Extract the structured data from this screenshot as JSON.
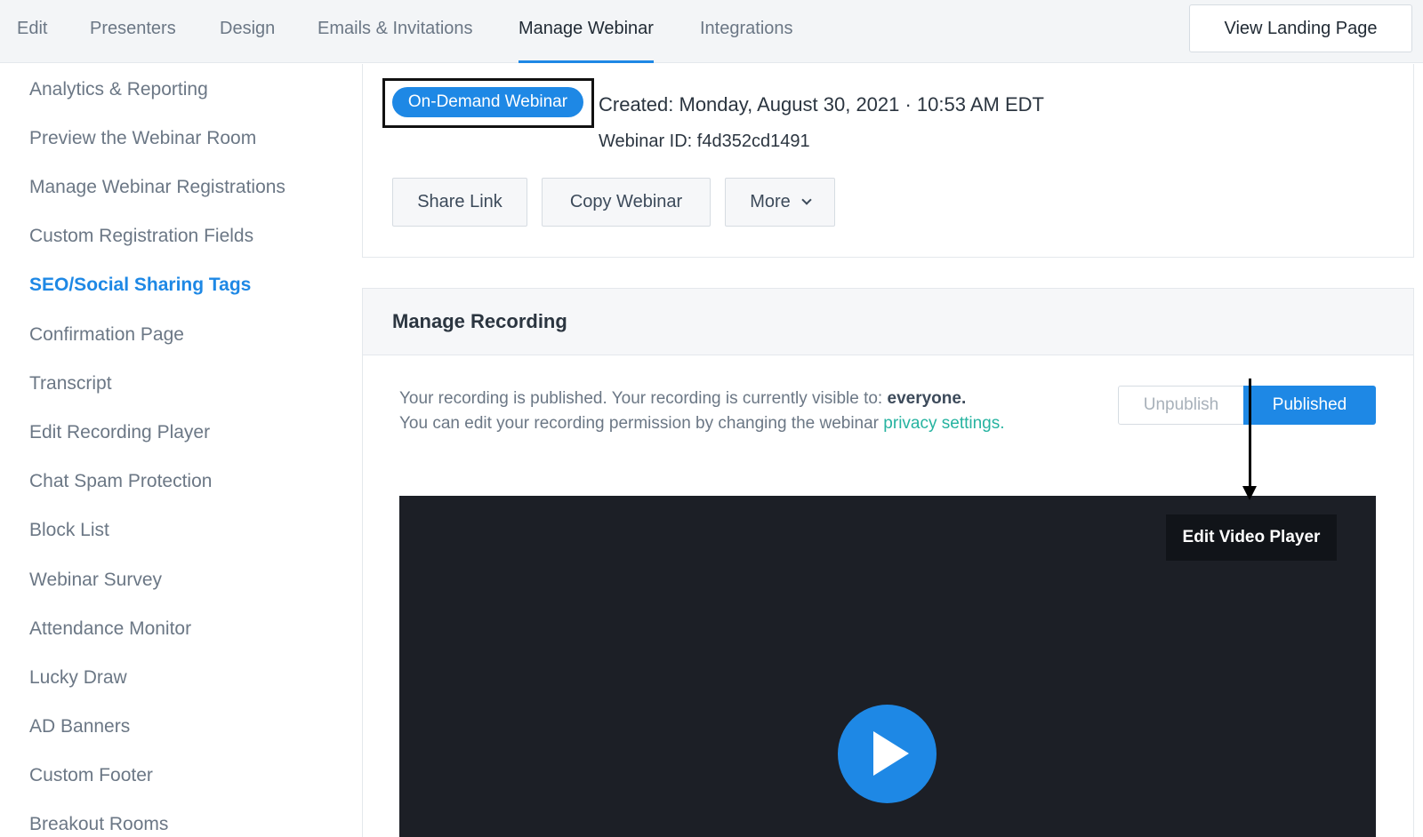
{
  "topnav": {
    "tabs": [
      "Edit",
      "Presenters",
      "Design",
      "Emails & Invitations",
      "Manage Webinar",
      "Integrations"
    ],
    "active_tab": "Manage Webinar",
    "landing_button": "View Landing Page"
  },
  "sidebar": {
    "items": [
      "Analytics & Reporting",
      "Preview the Webinar Room",
      "Manage Webinar Registrations",
      "Custom Registration Fields",
      "SEO/Social Sharing Tags",
      "Confirmation Page",
      "Transcript",
      "Edit Recording Player",
      "Chat Spam Protection",
      "Block List",
      "Webinar Survey",
      "Attendance Monitor",
      "Lucky Draw",
      "AD Banners",
      "Custom Footer",
      "Breakout Rooms"
    ],
    "active_item": "SEO/Social Sharing Tags"
  },
  "info": {
    "badge": "On-Demand Webinar",
    "created": "Created: Monday, August 30, 2021 · 10:53 AM EDT",
    "webinar_id": "Webinar ID: f4d352cd1491",
    "buttons": {
      "share": "Share Link",
      "copy": "Copy Webinar",
      "more": "More"
    }
  },
  "recording": {
    "title": "Manage Recording",
    "line1_prefix": "Your recording is published. Your recording is currently visible to: ",
    "line1_bold": "everyone.",
    "line2_prefix": "You can edit your recording permission by changing the webinar ",
    "line2_link": "privacy settings.",
    "unpublish": "Unpublish",
    "published": "Published",
    "edit_player": "Edit Video Player"
  },
  "colors": {
    "accent": "#1e88e5",
    "link": "#26b3a0",
    "video_bg": "#1c1f26"
  }
}
